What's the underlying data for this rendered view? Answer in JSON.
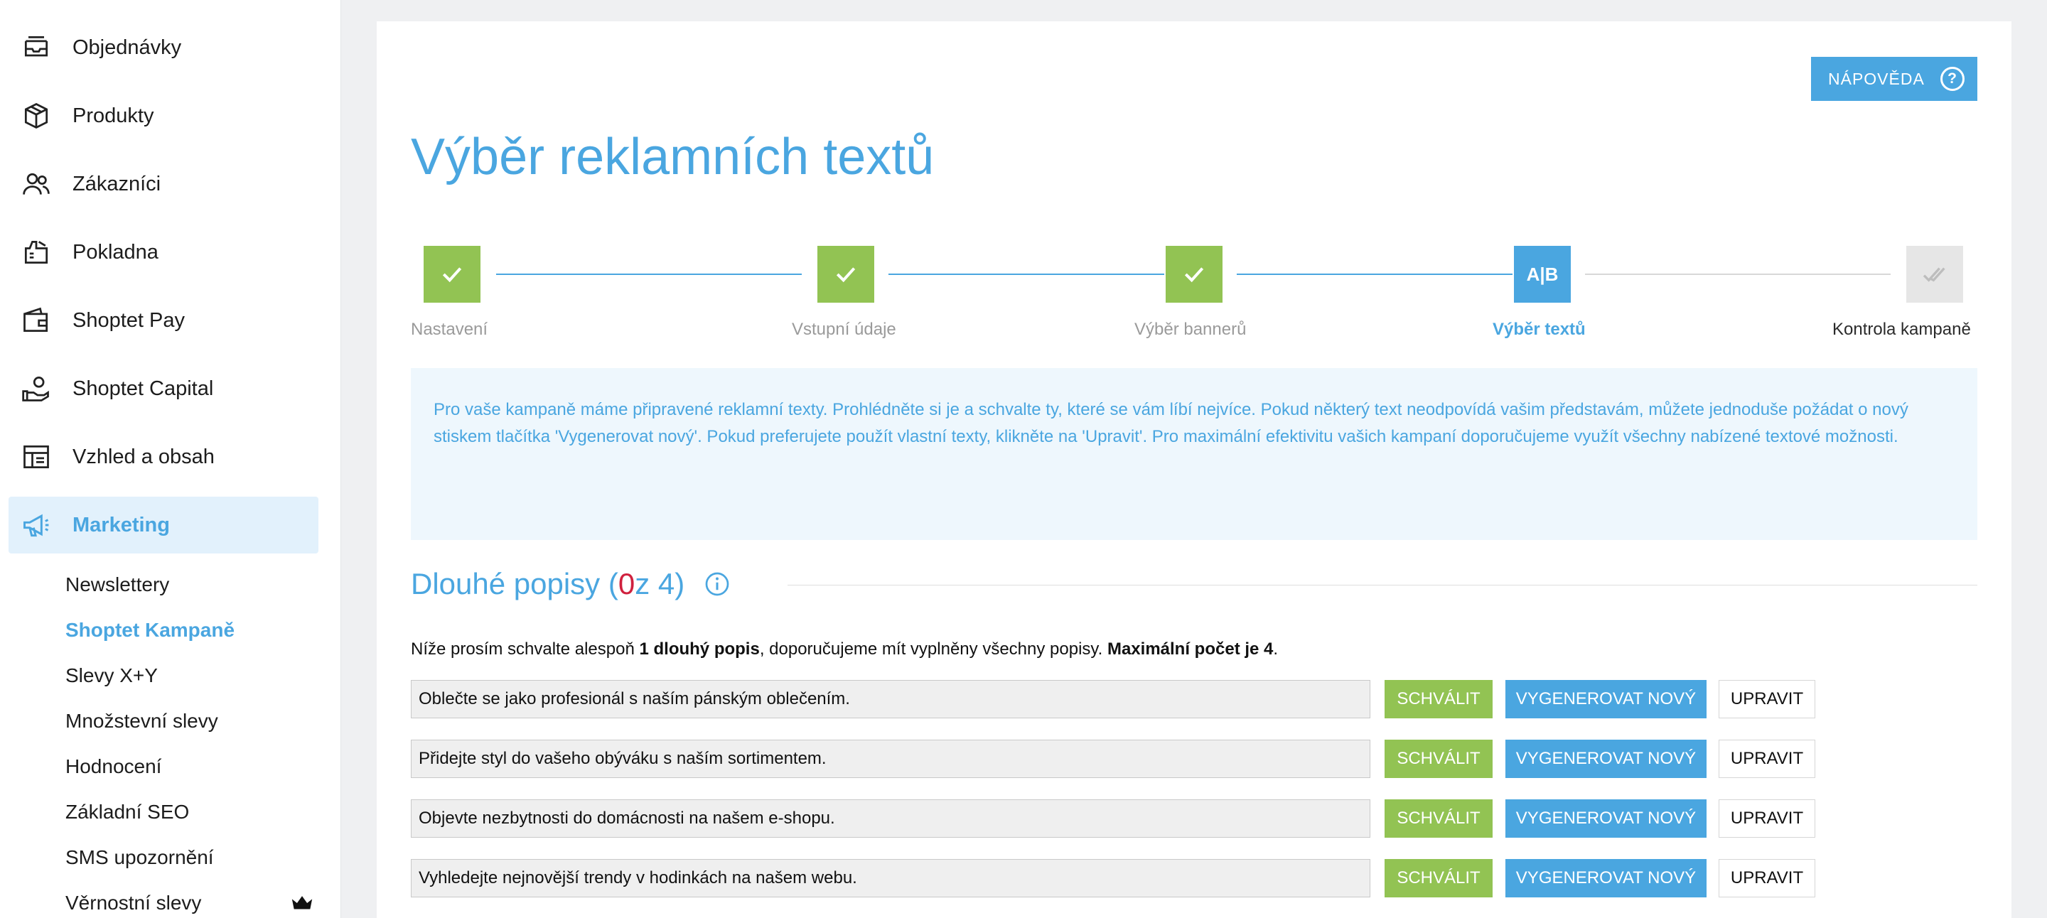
{
  "sidebar": {
    "items": [
      {
        "label": "Objednávky",
        "icon": "inbox-icon"
      },
      {
        "label": "Produkty",
        "icon": "box-icon"
      },
      {
        "label": "Zákazníci",
        "icon": "users-icon"
      },
      {
        "label": "Pokladna",
        "icon": "register-icon"
      },
      {
        "label": "Shoptet Pay",
        "icon": "wallet-icon"
      },
      {
        "label": "Shoptet Capital",
        "icon": "money-hand-icon"
      },
      {
        "label": "Vzhled a obsah",
        "icon": "layout-icon"
      },
      {
        "label": "Marketing",
        "icon": "megaphone-icon"
      }
    ],
    "sub_items": [
      {
        "label": "Newslettery"
      },
      {
        "label": "Shoptet Kampaně"
      },
      {
        "label": "Slevy X+Y"
      },
      {
        "label": "Množstevní slevy"
      },
      {
        "label": "Hodnocení"
      },
      {
        "label": "Základní SEO"
      },
      {
        "label": "SMS upozornění"
      },
      {
        "label": "Věrnostní slevy"
      }
    ],
    "accent_color": "#4aa6e0"
  },
  "header": {
    "help_label": "NÁPOVĚDA",
    "help_icon": "?",
    "title": "Výběr reklamních textů"
  },
  "stepper": {
    "steps": [
      {
        "label": "Nastavení",
        "state": "done"
      },
      {
        "label": "Vstupní údaje",
        "state": "done"
      },
      {
        "label": "Výběr bannerů",
        "state": "done"
      },
      {
        "label": "Výběr textů",
        "state": "current",
        "badge": "A|B"
      },
      {
        "label": "Kontrola kampaně",
        "state": "todo"
      }
    ]
  },
  "info_box": {
    "text": "Pro vaše kampaně máme připravené reklamní texty. Prohlédněte si je a schvalte ty, které se vám líbí nejvíce. Pokud některý text neodpovídá vašim představám, můžete jednoduše požádat o nový stiskem tlačítka 'Vygenerovat nový'. Pokud preferujete použít vlastní texty, klikněte na 'Upravit'. Pro maximální efektivitu vašich kampaní doporučujeme využít všechny nabízené textové možnosti."
  },
  "section": {
    "title_prefix": "Dlouhé popisy (",
    "count": "0",
    "title_suffix": " z 4)",
    "instruction": {
      "part1": "Níže prosím schvalte alespoň ",
      "bold1": "1 dlouhý popis",
      "part2": ", doporučujeme mít vyplněny všechny popisy. ",
      "bold2": "Maximální počet je 4",
      "part3": "."
    },
    "rows": [
      {
        "text": "Oblečte se jako profesionál s naším pánským oblečením."
      },
      {
        "text": "Přidejte styl do vašeho obýváku s naším sortimentem."
      },
      {
        "text": "Objevte nezbytnosti do domácnosti na našem e-shopu."
      },
      {
        "text": "Vyhledejte nejnovější trendy v hodinkách na našem webu."
      }
    ],
    "buttons": {
      "approve": "SCHVÁLIT",
      "regenerate": "VYGENEROVAT NOVÝ",
      "edit": "UPRAVIT"
    }
  },
  "colors": {
    "green": "#92c353",
    "blue": "#4aa6e0",
    "red": "#d0213e"
  }
}
